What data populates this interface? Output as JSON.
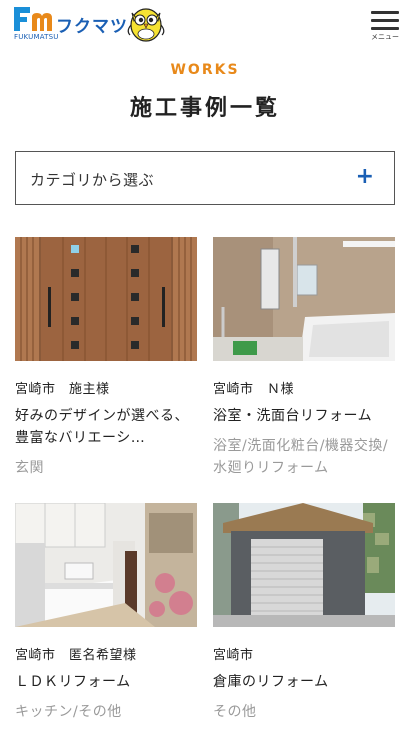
{
  "header": {
    "logo_mark": "Fm",
    "logo_sub": "FUKUMATSU",
    "logo_name": "フクマツ",
    "menu_label": "メニュー"
  },
  "section": {
    "label": "WORKS",
    "title": "施工事例一覧"
  },
  "category": {
    "label": "カテゴリから選ぶ",
    "icon": "plus-icon",
    "icon_glyph": "+"
  },
  "cards": [
    {
      "location": "宮崎市　施主様",
      "title": "好みのデザインが選べる、豊富なバリエーシ…",
      "tags": "玄関"
    },
    {
      "location": "宮崎市　Ｎ様",
      "title": "浴室・洗面台リフォーム",
      "tags": "浴室/洗面化粧台/機器交換/水廻りリフォーム"
    },
    {
      "location": "宮崎市　匿名希望様",
      "title": "ＬＤＫリフォーム",
      "tags": "キッチン/その他"
    },
    {
      "location": "宮崎市",
      "title": "倉庫のリフォーム",
      "tags": "その他"
    }
  ],
  "colors": {
    "brand_blue": "#1a5fb4",
    "accent_orange": "#e8891a",
    "tag_gray": "#9a9a9a"
  }
}
